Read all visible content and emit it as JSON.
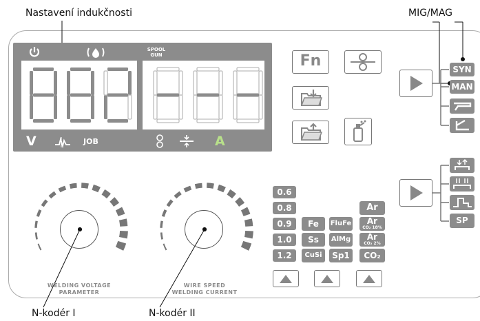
{
  "callouts": {
    "inductance": "Nastavení indukčnosti",
    "mig_mag": "MIG/MAG",
    "encoder1": "N-kodér I",
    "encoder2": "N-kodér II"
  },
  "display": {
    "spool_gun_line1": "SPOOL",
    "spool_gun_line2": "GUN",
    "left_value": "882",
    "right_value": "---",
    "indicator_v": "V",
    "indicator_job": "JOB",
    "indicator_a": "A"
  },
  "mode_buttons": {
    "syn": "SYN",
    "man": "MAN"
  },
  "process_buttons": {
    "sp": "SP"
  },
  "wire_diameters": [
    "0.6",
    "0.8",
    "0.9",
    "1.0",
    "1.2"
  ],
  "materials_col1": [
    "Fe",
    "Ss",
    "CuSi"
  ],
  "materials_col2": [
    "FluFe",
    "AlMg",
    "Sp1"
  ],
  "gas": {
    "ar": "Ar",
    "ar2_main": "Ar",
    "ar2_sub": "CO₂ 18%",
    "ar3_main": "Ar",
    "ar3_sub": "CO₂ 2%",
    "co2": "CO₂"
  },
  "knobs": {
    "left_line1": "WELDING VOLTAGE",
    "left_line2": "PARAMETER",
    "right_line1": "WIRE SPEED",
    "right_line2": "WELDING CURRENT"
  },
  "icons": {
    "fn": "Fn"
  },
  "colors": {
    "display_bg": "#8c8c8c",
    "segment_on": "#8c8c8c",
    "segment_off": "#bdbdbd",
    "accent_green": "#b8e08a"
  }
}
